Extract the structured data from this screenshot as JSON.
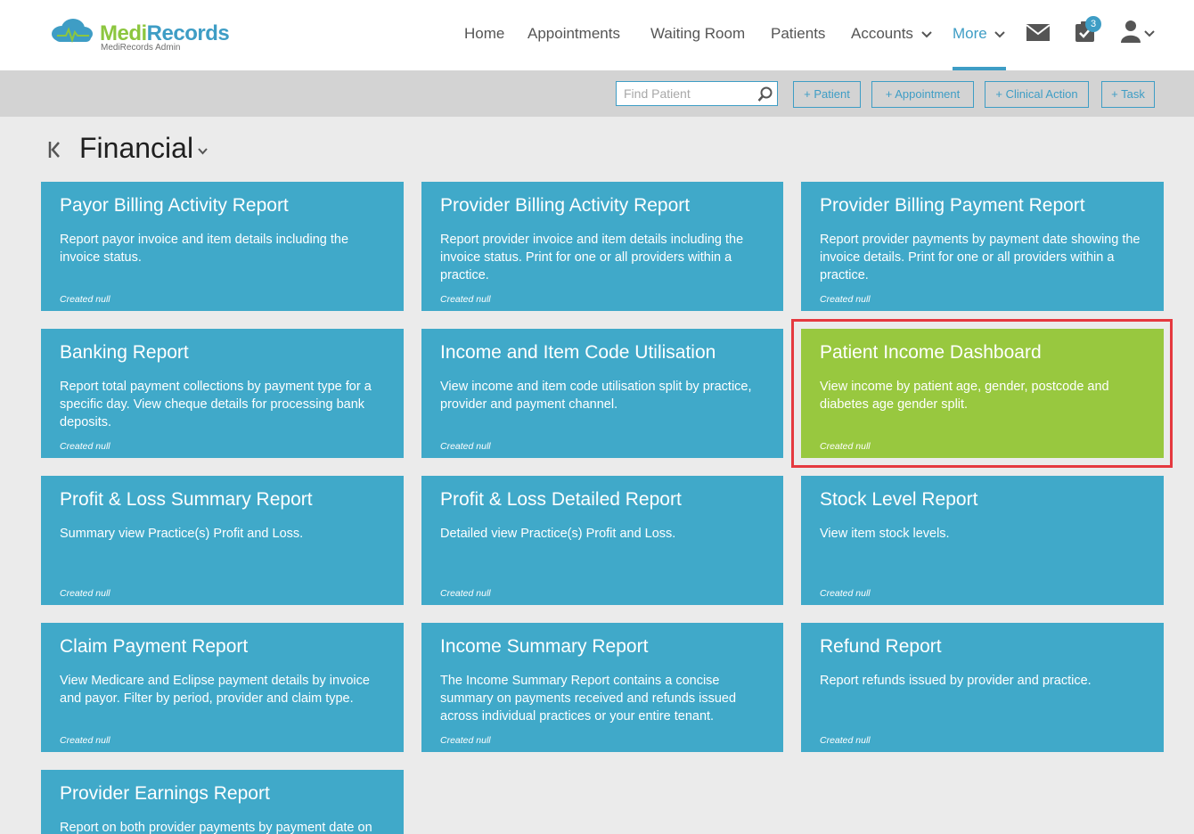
{
  "brand": {
    "name_part1": "Medi",
    "name_part2": "Records",
    "subtitle": "MediRecords Admin"
  },
  "nav": {
    "items": [
      {
        "label": "Home"
      },
      {
        "label": "Appointments"
      },
      {
        "label": "Waiting Room"
      },
      {
        "label": "Patients"
      },
      {
        "label": "Accounts"
      },
      {
        "label": "More"
      }
    ],
    "active": "More",
    "tasks_badge": "3"
  },
  "actions": {
    "find_placeholder": "Find Patient",
    "add_patient": "+ Patient",
    "add_appointment": "+ Appointment",
    "add_clinical_action": "+ Clinical Action",
    "add_task": "+ Task"
  },
  "page": {
    "title": "Financial"
  },
  "colors": {
    "card": "#40a9c9",
    "card_selected": "#98c83f",
    "highlight": "#e5393f",
    "accent": "#3e9dc5"
  },
  "cards": [
    {
      "title": "Payor Billing Activity Report",
      "desc": "Report payor invoice and item details including the invoice status.",
      "foot": "Created null"
    },
    {
      "title": "Provider Billing Activity Report",
      "desc": "Report provider invoice and item details including the invoice status. Print for one or all providers within a practice.",
      "foot": "Created null"
    },
    {
      "title": "Provider Billing Payment Report",
      "desc": "Report provider payments by payment date showing the invoice details. Print for one or all providers within a practice.",
      "foot": "Created null"
    },
    {
      "title": "Banking Report",
      "desc": "Report total payment collections by payment type for a specific day. View cheque details for processing bank deposits.",
      "foot": "Created null"
    },
    {
      "title": "Income and Item Code Utilisation",
      "desc": "View income and item code utilisation split by practice, provider and payment channel.",
      "foot": "Created null"
    },
    {
      "title": "Patient Income Dashboard",
      "desc": "View income by patient age, gender, postcode and diabetes age gender split.",
      "foot": "Created null",
      "selected": true
    },
    {
      "title": "Profit & Loss Summary Report",
      "desc": "Summary view Practice(s) Profit and Loss.",
      "foot": "Created null"
    },
    {
      "title": "Profit & Loss Detailed Report",
      "desc": "Detailed view Practice(s) Profit and Loss.",
      "foot": "Created null"
    },
    {
      "title": "Stock Level Report",
      "desc": "View item stock levels.",
      "foot": "Created null"
    },
    {
      "title": "Claim Payment Report",
      "desc": "View Medicare and Eclipse payment details by invoice and payor. Filter by period, provider and claim type.",
      "foot": "Created null"
    },
    {
      "title": "Income Summary Report",
      "desc": "The Income Summary Report contains a concise summary on payments received and refunds issued across individual practices or your entire tenant.",
      "foot": "Created null"
    },
    {
      "title": "Refund Report",
      "desc": "Report refunds issued by provider and practice.",
      "foot": "Created null"
    },
    {
      "title": "Provider Earnings Report",
      "desc": "Report on both provider payments by payment date on",
      "foot": ""
    }
  ]
}
